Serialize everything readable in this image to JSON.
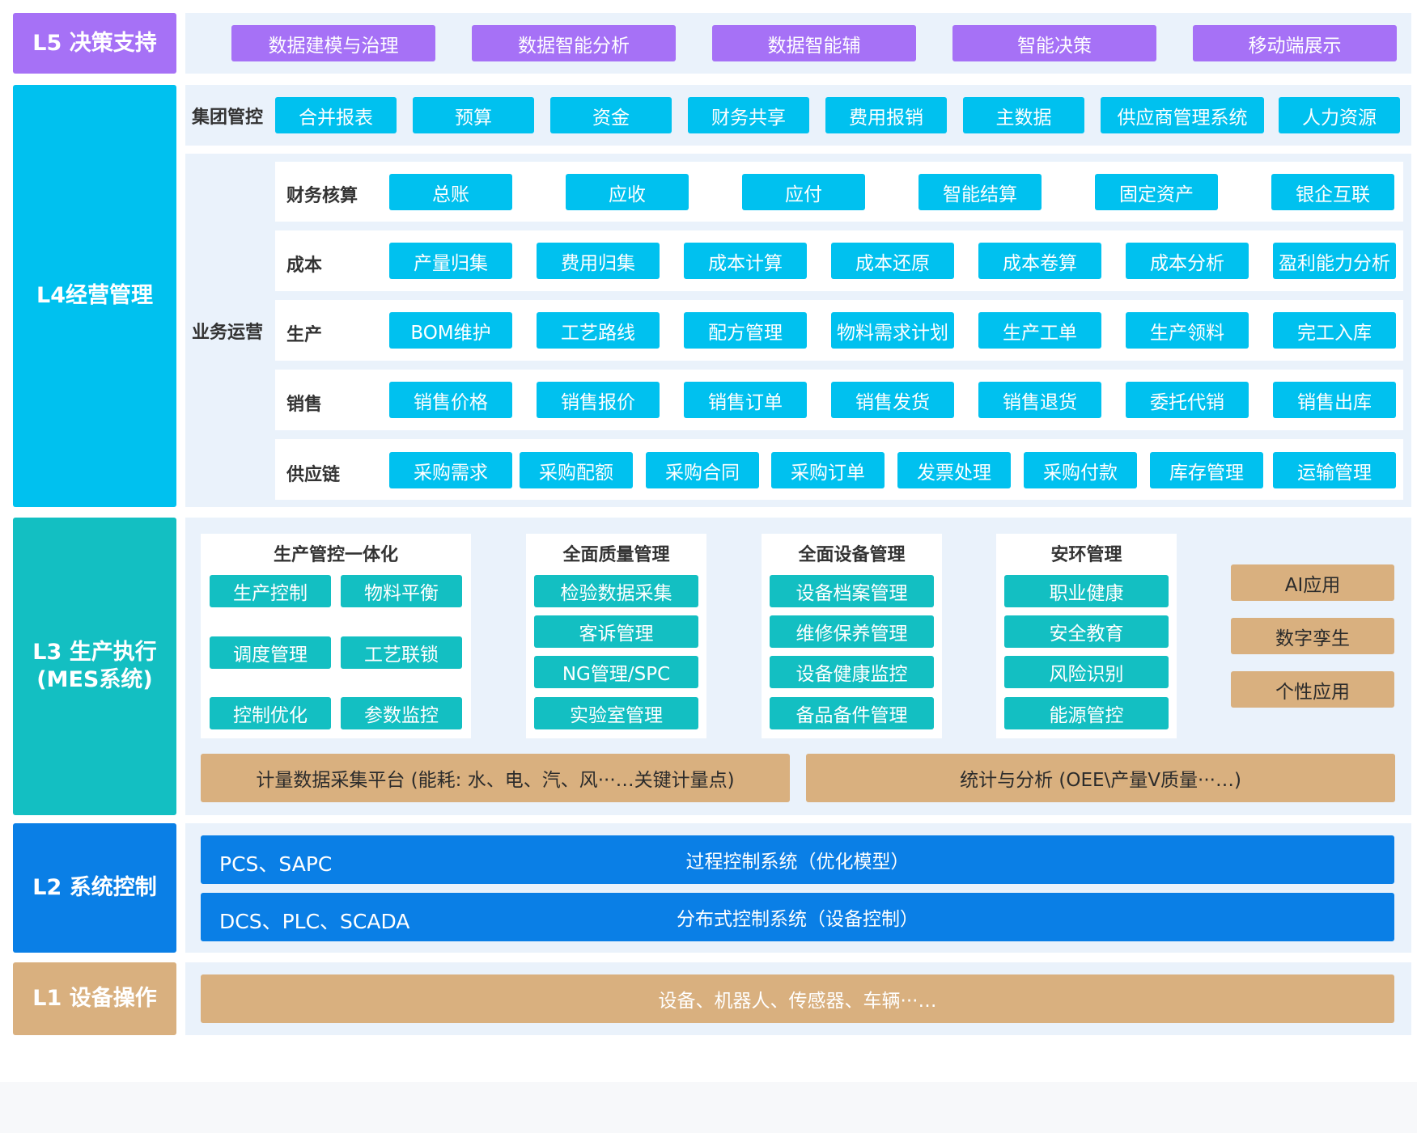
{
  "colors": {
    "l5": "#a671f6",
    "l4": "#00c1ef",
    "l3": "#13bfc2",
    "l2": "#0a7fe6",
    "l1": "#d9b07f"
  },
  "l5": {
    "label": "L5 决策支持",
    "items": [
      "数据建模与治理",
      "数据智能分析",
      "数据智能辅",
      "智能决策",
      "移动端展示"
    ]
  },
  "l4": {
    "label": "L4经营管理",
    "group": {
      "label": "集团管控",
      "items": [
        "合并报表",
        "预算",
        "资金",
        "财务共享",
        "费用报销",
        "主数据",
        "供应商管理系统",
        "人力资源"
      ]
    },
    "business": {
      "label": "业务运营",
      "rows": [
        {
          "label": "财务核算",
          "items": [
            "总账",
            "应收",
            "应付",
            "智能结算",
            "固定资产",
            "银企互联"
          ]
        },
        {
          "label": "成本",
          "items": [
            "产量归集",
            "费用归集",
            "成本计算",
            "成本还原",
            "成本卷算",
            "成本分析",
            "盈利能力分析"
          ]
        },
        {
          "label": "生产",
          "items": [
            "BOM维护",
            "工艺路线",
            "配方管理",
            "物料需求计划",
            "生产工单",
            "生产领料",
            "完工入库"
          ]
        },
        {
          "label": "销售",
          "items": [
            "销售价格",
            "销售报价",
            "销售订单",
            "销售发货",
            "销售退货",
            "委托代销",
            "销售出库"
          ]
        },
        {
          "label": "供应链",
          "items": [
            "采购需求",
            "采购配额",
            "采购合同",
            "采购订单",
            "发票处理",
            "采购付款",
            "库存管理",
            "运输管理"
          ]
        }
      ]
    }
  },
  "l3": {
    "label_line1": "L3 生产执行",
    "label_line2": "(MES系统)",
    "boxes": [
      {
        "title": "生产管控一体化",
        "items": [
          "生产控制",
          "物料平衡",
          "调度管理",
          "工艺联锁",
          "控制优化",
          "参数监控"
        ]
      },
      {
        "title": "全面质量管理",
        "items": [
          "检验数据采集",
          "客诉管理",
          "NG管理/SPC",
          "实验室管理"
        ]
      },
      {
        "title": "全面设备管理",
        "items": [
          "设备档案管理",
          "维修保养管理",
          "设备健康监控",
          "备品备件管理"
        ]
      },
      {
        "title": "安环管理",
        "items": [
          "职业健康",
          "安全教育",
          "风险识别",
          "能源管控"
        ]
      }
    ],
    "apps": [
      "AI应用",
      "数字孪生",
      "个性应用"
    ],
    "platform": "计量数据采集平台 (能耗: 水、电、汽、风···…关键计量点)",
    "stats": "统计与分析 (OEE\\产量V质量···…)"
  },
  "l2": {
    "label": "L2 系统控制",
    "bars": [
      {
        "left": "PCS、SAPC",
        "center": "过程控制系统（优化模型）"
      },
      {
        "left": "DCS、PLC、SCADA",
        "center": "分布式控制系统（设备控制）"
      }
    ]
  },
  "l1": {
    "label": "L1 设备操作",
    "bar": "设备、机器人、传感器、车辆···…"
  }
}
